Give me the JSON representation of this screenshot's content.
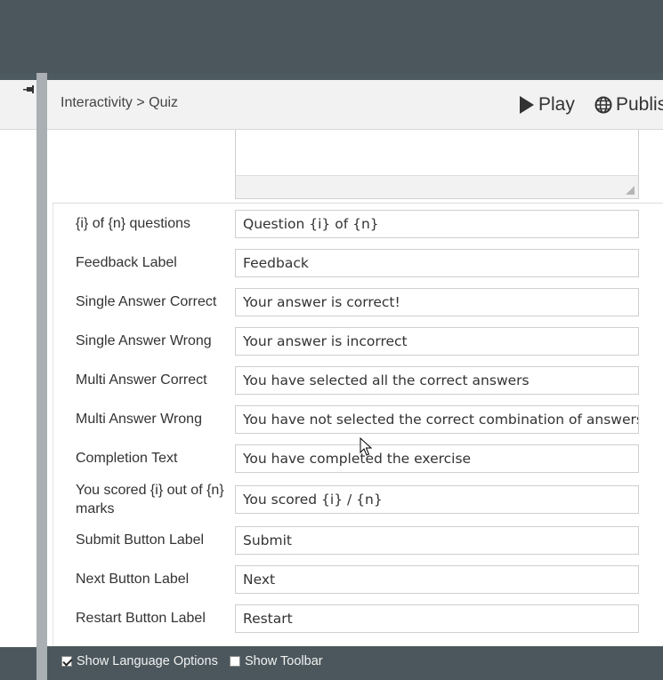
{
  "header": {
    "breadcrumb": "Interactivity > Quiz",
    "play_label": "Play",
    "publish_label": "Publis"
  },
  "rows": [
    {
      "label": "{i} of {n} questions",
      "value": "Question {i} of {n}"
    },
    {
      "label": "Feedback Label",
      "value": "Feedback"
    },
    {
      "label": "Single Answer Correct",
      "value": "Your answer is correct!"
    },
    {
      "label": "Single Answer Wrong",
      "value": "Your answer is incorrect"
    },
    {
      "label": "Multi Answer Correct",
      "value": "You have selected all the correct answers"
    },
    {
      "label": "Multi Answer Wrong",
      "value": "You have not selected the correct combination of answers"
    },
    {
      "label": "Completion Text",
      "value": "You have completed the exercise"
    },
    {
      "label": "You scored {i} out of {n} marks",
      "value": "You scored {i} / {n}"
    },
    {
      "label": "Submit Button Label",
      "value": "Submit"
    },
    {
      "label": "Next Button Label",
      "value": "Next"
    },
    {
      "label": "Restart Button Label",
      "value": "Restart"
    }
  ],
  "footer": {
    "show_language_options": {
      "label": "Show Language Options",
      "checked": true
    },
    "show_toolbar": {
      "label": "Show Toolbar",
      "checked": false
    }
  },
  "icons": {
    "play": "play-icon",
    "publish": "globe-icon",
    "pin": "pin-icon"
  }
}
